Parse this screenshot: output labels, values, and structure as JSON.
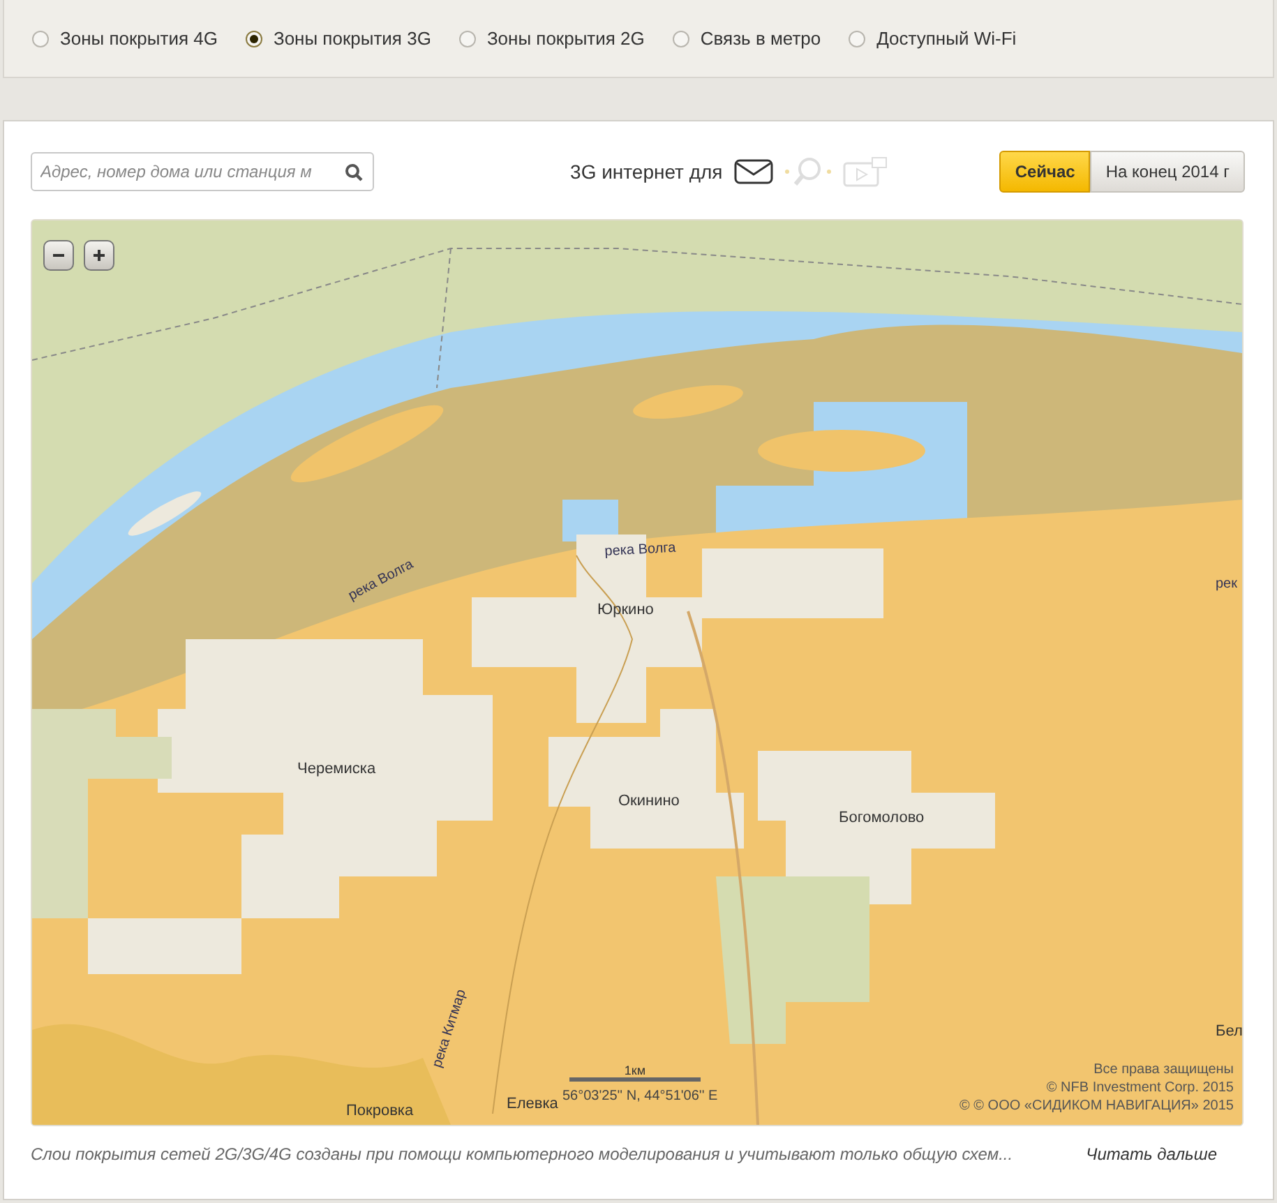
{
  "layers": [
    {
      "label": "Зоны покрытия 4G",
      "selected": false
    },
    {
      "label": "Зоны покрытия 3G",
      "selected": true
    },
    {
      "label": "Зоны покрытия 2G",
      "selected": false
    },
    {
      "label": "Связь в метро",
      "selected": false
    },
    {
      "label": "Доступный Wi-Fi",
      "selected": false
    }
  ],
  "search": {
    "placeholder": "Адрес, номер дома или станция м"
  },
  "usage": {
    "label": "3G интернет для"
  },
  "periods": [
    {
      "label": "Сейчас",
      "selected": true
    },
    {
      "label": "На конец 2014 г",
      "selected": false
    }
  ],
  "map": {
    "labels": [
      {
        "text": "река Волга",
        "kind": "river"
      },
      {
        "text": "река Волга",
        "kind": "river"
      },
      {
        "text": "рек",
        "kind": "river"
      },
      {
        "text": "Юркино",
        "kind": "place"
      },
      {
        "text": "Черемиска",
        "kind": "place"
      },
      {
        "text": "Окинино",
        "kind": "place"
      },
      {
        "text": "Богомолово",
        "kind": "place"
      },
      {
        "text": "Бел",
        "kind": "place"
      },
      {
        "text": "река Китмар",
        "kind": "river"
      },
      {
        "text": "Елевка",
        "kind": "place"
      },
      {
        "text": "Покровка",
        "kind": "place"
      }
    ],
    "scale": "1км",
    "coordinates": "56°03'25'' N, 44°51'06'' E",
    "copyright": [
      "Все права защищены",
      "©  NFB Investment Corp. 2015",
      "© © ООО «СИДИКОМ НАВИГАЦИЯ» 2015"
    ]
  },
  "footnote": {
    "text": "Слои покрытия сетей 2G/3G/4G созданы при помощи компьютерного моделирования и учитывают только общую схем...",
    "link": "Читать дальше"
  }
}
